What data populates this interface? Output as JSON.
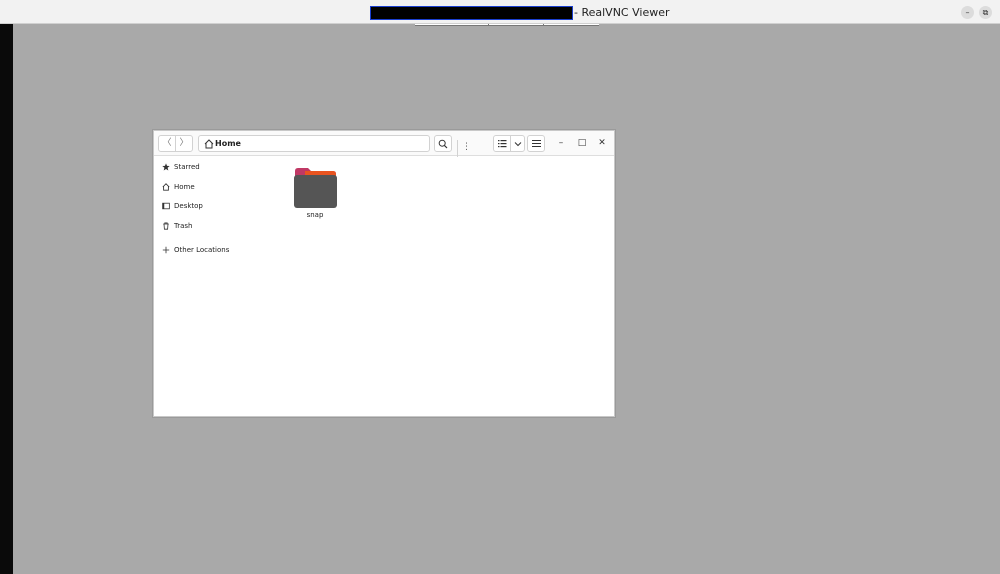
{
  "window": {
    "title_suffix": "- RealVNC Viewer",
    "controls": {
      "minimize": "–",
      "restore": "⧉"
    }
  },
  "file_manager": {
    "path": {
      "label": "Home",
      "menu": "⋮"
    },
    "nav": {
      "back": "〈",
      "forward": "〉"
    },
    "toolbar": {
      "search": "search-icon",
      "list_view": "list-view-icon",
      "view_dropdown": "chevron-down-icon",
      "menu": "hamburger-menu-icon"
    },
    "window_controls": {
      "minimize": "–",
      "maximize": "□",
      "close": "✕"
    },
    "sidebar": {
      "items": [
        {
          "label": "Starred",
          "icon": "star-icon"
        },
        {
          "label": "Home",
          "icon": "home-icon"
        },
        {
          "label": "Desktop",
          "icon": "desktop-icon"
        },
        {
          "label": "Trash",
          "icon": "trash-icon"
        },
        {
          "label": "Other Locations",
          "icon": "plus-icon"
        }
      ]
    },
    "content": {
      "items": [
        {
          "label": "snap",
          "icon": "folder-icon"
        }
      ]
    }
  },
  "colors": {
    "desktop_bg": "#a9a9a9",
    "folder_body": "#555555",
    "folder_tab": "#e95420",
    "folder_accent": "#c03865"
  }
}
